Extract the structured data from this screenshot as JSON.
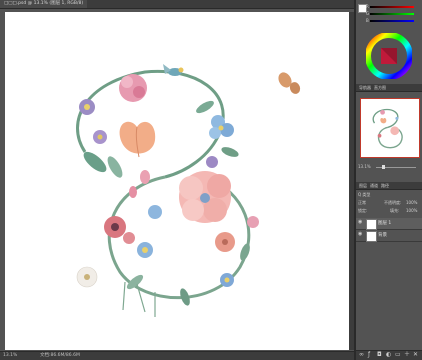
{
  "document": {
    "tab_label": "□□□.psd @ 13.1% (图层 1, RGB/8)",
    "zoom": "13.1%",
    "doc_size": "文档:86.6M/86.6M"
  },
  "color_panel": {
    "tabs": [
      "颜色",
      "色板"
    ],
    "wheel_colors": [
      "#ff0000",
      "#ffff00",
      "#00ff00",
      "#00ffff",
      "#0000ff",
      "#ff00ff"
    ]
  },
  "navigator": {
    "tabs": [
      "导航器",
      "直方图"
    ],
    "zoom": "13.1%"
  },
  "layers": {
    "tabs": [
      "图层",
      "通道",
      "路径"
    ],
    "kind_label": "Q 类型",
    "blend_mode": "正常",
    "opacity_label": "不透明度:",
    "opacity_value": "100%",
    "lock_label": "锁定:",
    "fill_label": "填充:",
    "fill_value": "100%",
    "items": [
      {
        "name": "图层 1",
        "visible": true
      },
      {
        "name": "背景",
        "visible": true
      }
    ]
  },
  "colors": {
    "panel_bg": "#535353",
    "header_bg": "#3c3c3c",
    "canvas_bg": "#ffffff",
    "accent_red": "#c0392b"
  }
}
